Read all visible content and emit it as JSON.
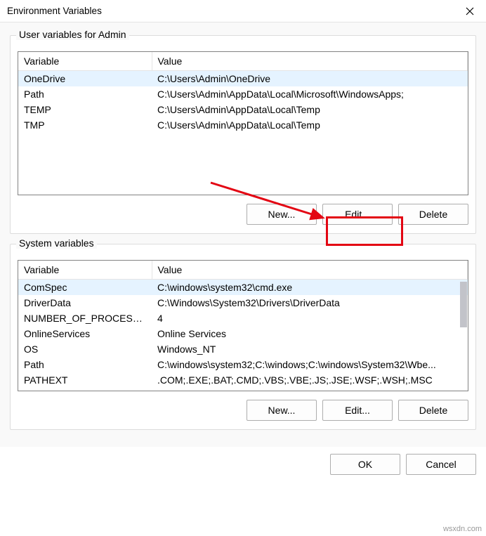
{
  "title": "Environment Variables",
  "userSection": {
    "label": "User variables for Admin",
    "headers": {
      "variable": "Variable",
      "value": "Value"
    },
    "rows": [
      {
        "variable": "OneDrive",
        "value": "C:\\Users\\Admin\\OneDrive",
        "selected": true
      },
      {
        "variable": "Path",
        "value": "C:\\Users\\Admin\\AppData\\Local\\Microsoft\\WindowsApps;",
        "selected": false
      },
      {
        "variable": "TEMP",
        "value": "C:\\Users\\Admin\\AppData\\Local\\Temp",
        "selected": false
      },
      {
        "variable": "TMP",
        "value": "C:\\Users\\Admin\\AppData\\Local\\Temp",
        "selected": false
      }
    ],
    "buttons": {
      "new": "New...",
      "edit": "Edit...",
      "delete": "Delete"
    }
  },
  "systemSection": {
    "label": "System variables",
    "headers": {
      "variable": "Variable",
      "value": "Value"
    },
    "rows": [
      {
        "variable": "ComSpec",
        "value": "C:\\windows\\system32\\cmd.exe",
        "selected": true
      },
      {
        "variable": "DriverData",
        "value": "C:\\Windows\\System32\\Drivers\\DriverData",
        "selected": false
      },
      {
        "variable": "NUMBER_OF_PROCESSORS",
        "value": "4",
        "selected": false
      },
      {
        "variable": "OnlineServices",
        "value": "Online Services",
        "selected": false
      },
      {
        "variable": "OS",
        "value": "Windows_NT",
        "selected": false
      },
      {
        "variable": "Path",
        "value": "C:\\windows\\system32;C:\\windows;C:\\windows\\System32\\Wbe...",
        "selected": false
      },
      {
        "variable": "PATHEXT",
        "value": ".COM;.EXE;.BAT;.CMD;.VBS;.VBE;.JS;.JSE;.WSF;.WSH;.MSC",
        "selected": false
      }
    ],
    "buttons": {
      "new": "New...",
      "edit": "Edit...",
      "delete": "Delete"
    }
  },
  "dialogButtons": {
    "ok": "OK",
    "cancel": "Cancel"
  },
  "watermark": "wsxdn.com"
}
